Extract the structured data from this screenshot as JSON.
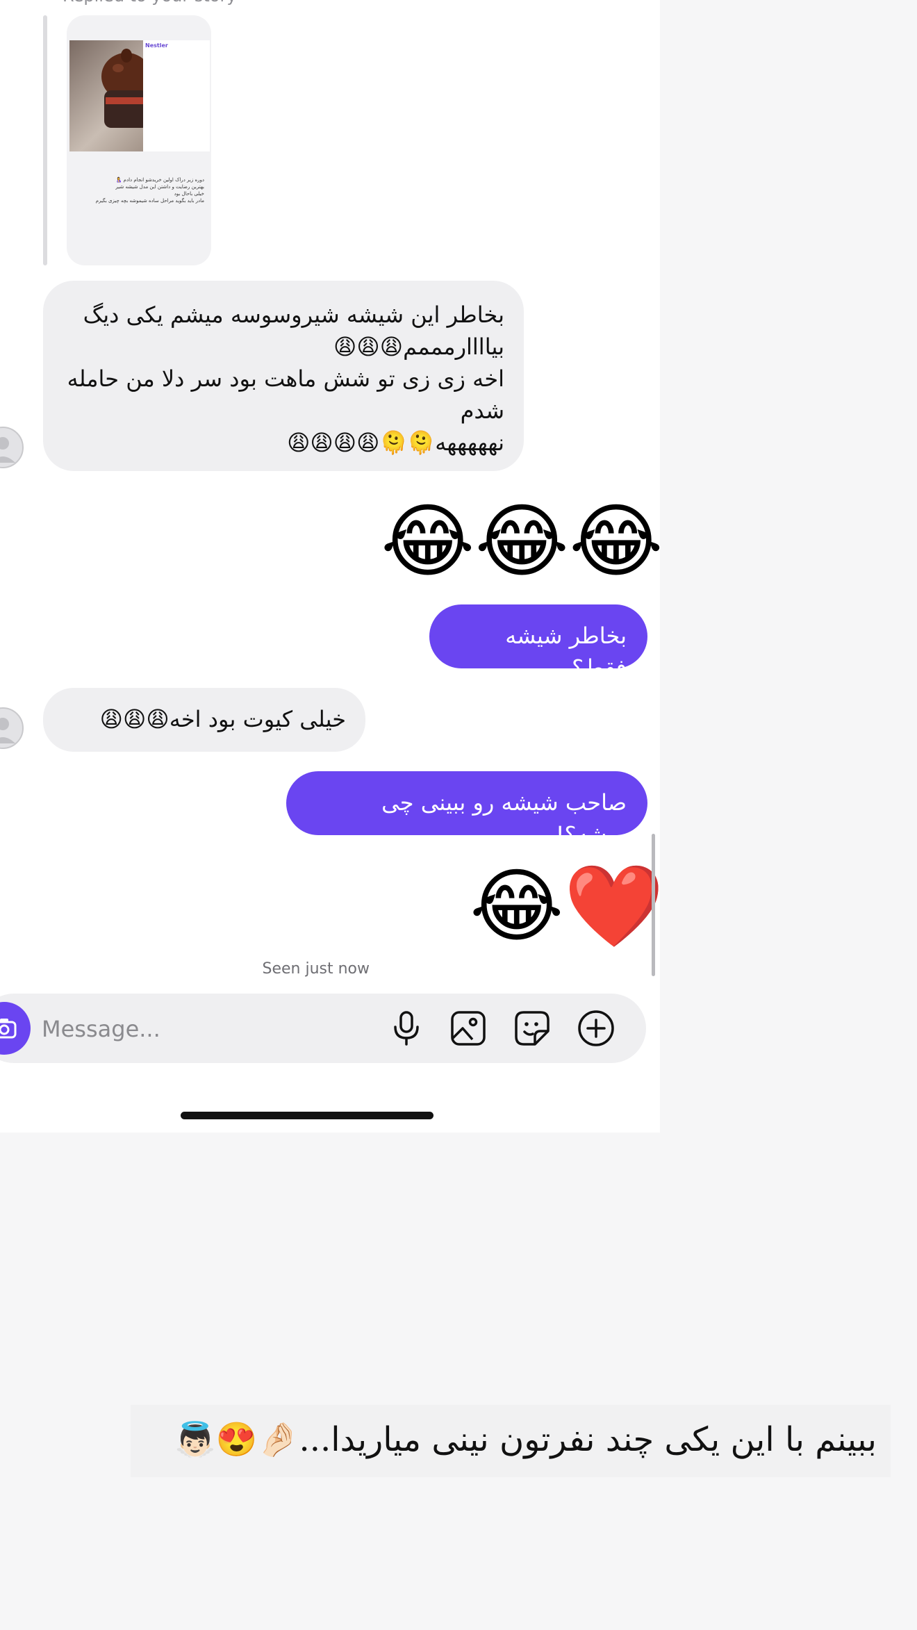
{
  "story_reply": {
    "caption": "Replied to your story",
    "brand": "Nestler",
    "story_text_lines": [
      "بهترین رضایت و داشتن این مدل شیشه شیر",
      "خیلی باحال بود",
      "مادر باید بگوید مراحل ساده شیموشه بچه چیزی بگیرم"
    ],
    "story_headline": "دوره زیر دراک اولین خریدشو انجام دادم 🤱"
  },
  "messages": [
    {
      "id": "m1",
      "direction": "incoming",
      "text": "بخاطر این شیشه شیروسوسه میشم یکی دیگ بیاااارمممم😩😩😩\nاخه زی زی تو شش ماهت بود سر دلا من حامله شدم\nنهههههه🫠🫠😩😩😩😩"
    },
    {
      "id": "m2",
      "direction": "outgoing",
      "emoji_only": true,
      "text": "😂😂😂"
    },
    {
      "id": "m3",
      "direction": "outgoing",
      "text": "بخاطر شیشه فقط؟"
    },
    {
      "id": "m4",
      "direction": "incoming",
      "text": "خیلی کیوت بود اخه😩😩😩"
    },
    {
      "id": "m5",
      "direction": "outgoing",
      "text": "صاحب شیشه رو ببینی چی میشه؟!"
    },
    {
      "id": "m6",
      "direction": "outgoing",
      "emoji_only": true,
      "text": "😂❤️"
    }
  ],
  "status": {
    "seen": "Seen just now"
  },
  "composer": {
    "placeholder": "Message...",
    "icons": [
      "camera-icon",
      "microphone-icon",
      "gallery-icon",
      "sticker-icon",
      "plus-icon"
    ]
  },
  "overlay_caption": "ببینم با این یکی چند نفرتون نینی میاریدا...🤌🏻😍👼🏻",
  "colors": {
    "outgoing_bubble": "#6a45f1",
    "incoming_bubble": "#efeff1",
    "background": "#f6f6f7"
  }
}
